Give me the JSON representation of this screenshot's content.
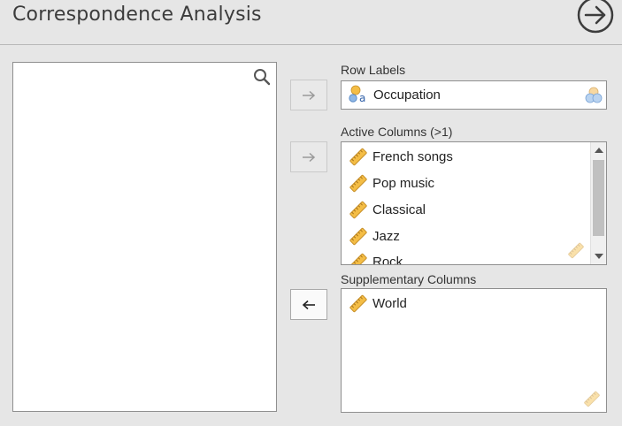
{
  "header": {
    "title": "Correspondence Analysis",
    "run_icon": "arrow-right-circle-icon"
  },
  "source": {
    "search_icon": "search-icon"
  },
  "row_labels": {
    "label": "Row Labels",
    "item": "Occupation",
    "type_icon": "nominal-icon"
  },
  "active_columns": {
    "label": "Active Columns (>1)",
    "items": [
      "French songs",
      "Pop music",
      "Classical",
      "Jazz",
      "Rock"
    ],
    "type_icon": "ruler-icon"
  },
  "supplementary_columns": {
    "label": "Supplementary Columns",
    "items": [
      "World"
    ],
    "type_icon": "ruler-icon"
  },
  "buttons": {
    "row_move": "right-arrow-icon",
    "active_move": "right-arrow-icon",
    "supp_move": "left-arrow-icon"
  },
  "colors": {
    "ruler": "#f0b43a",
    "nominal_blue": "#6aa0d8",
    "nominal_orange": "#f0b43a"
  }
}
